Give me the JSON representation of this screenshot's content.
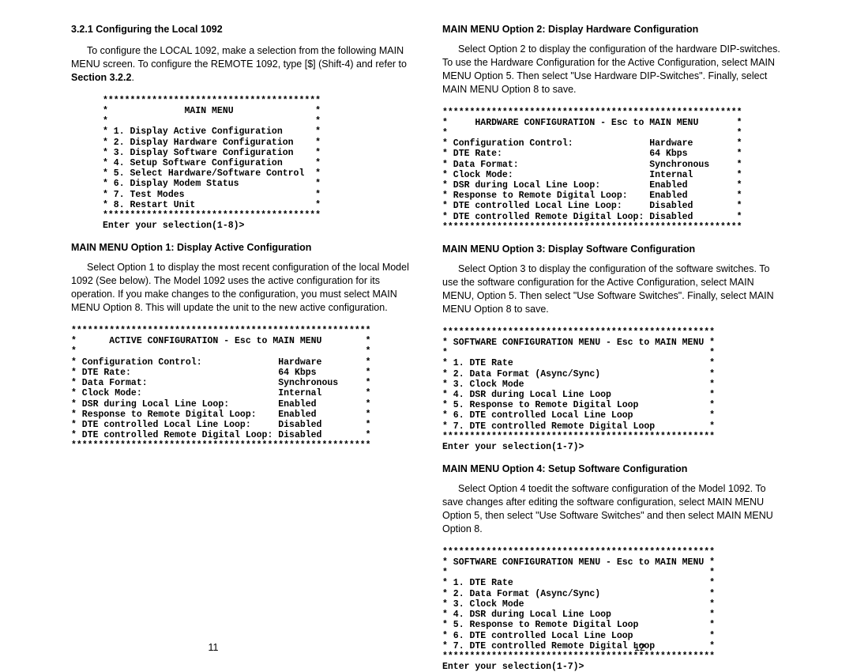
{
  "left": {
    "h1": "3.2.1  Configuring the Local 1092",
    "p1a": "To configure the LOCAL 1092, make a selection from the following MAIN MENU screen.  To configure the REMOTE 1092, type [$] (Shift-4) and refer to ",
    "p1ref": "Section 3.2.2",
    "p1b": ".",
    "main_menu": "****************************************\n*              MAIN MENU               *\n*                                      *\n* 1. Display Active Configuration      *\n* 2. Display Hardware Configuration    *\n* 3. Display Software Configuration    *\n* 4. Setup Software Configuration      *\n* 5. Select Hardware/Software Control  *\n* 6. Display Modem Status              *\n* 7. Test Modes                        *\n* 8. Restart Unit                      *\n****************************************\nEnter your selection(1-8)>",
    "h2": "MAIN MENU Option 1:  Display Active Configuration",
    "p2": "Select Option 1 to display the most recent configuration of the local Model 1092 (See below).  The Model 1092 uses the active configuration for its operation.  If you make changes to the configuration, you must select MAIN MENU Option 8.  This will update the unit to the new active configuration.",
    "active_cfg": "*******************************************************\n*      ACTIVE CONFIGURATION - Esc to MAIN MENU        *\n*                                                     *\n* Configuration Control:              Hardware        *\n* DTE Rate:                           64 Kbps         *\n* Data Format:                        Synchronous     *\n* Clock Mode:                         Internal        *\n* DSR during Local Line Loop:         Enabled         *\n* Response to Remote Digital Loop:    Enabled         *\n* DTE controlled Local Line Loop:     Disabled        *\n* DTE controlled Remote Digital Loop: Disabled        *\n*******************************************************",
    "pagenum": "11"
  },
  "right": {
    "h1": "MAIN MENU Option 2:  Display Hardware Configuration",
    "p1": "Select Option 2 to display the configuration of the hardware DIP-switches.  To use the Hardware Configuration for the Active Configuration, select MAIN MENU Option 5.  Then select \"Use Hardware DIP-Switches\".  Finally, select MAIN MENU Option 8 to save.",
    "hw_cfg": "*******************************************************\n*     HARDWARE CONFIGURATION - Esc to MAIN MENU       *\n*                                                     *\n* Configuration Control:              Hardware        *\n* DTE Rate:                           64 Kbps         *\n* Data Format:                        Synchronous     *\n* Clock Mode:                         Internal        *\n* DSR during Local Line Loop:         Enabled         *\n* Response to Remote Digital Loop:    Enabled         *\n* DTE controlled Local Line Loop:     Disabled        *\n* DTE controlled Remote Digital Loop: Disabled        *\n*******************************************************",
    "h2": "MAIN MENU Option 3:  Display Software Configuration",
    "p2": "Select Option 3 to display the configuration of the software switches.  To use the software configuration for the Active Configuration, select MAIN MENU, Option 5.  Then select \"Use Software Switches\".  Finally, select MAIN MENU Option 8 to save.",
    "sw_menu": "**************************************************\n* SOFTWARE CONFIGURATION MENU - Esc to MAIN MENU *\n*                                                *\n* 1. DTE Rate                                    *\n* 2. Data Format (Async/Sync)                    *\n* 3. Clock Mode                                  *\n* 4. DSR during Local Line Loop                  *\n* 5. Response to Remote Digital Loop             *\n* 6. DTE controlled Local Line Loop              *\n* 7. DTE controlled Remote Digital Loop          *\n**************************************************\nEnter your selection(1-7)>",
    "h3": "MAIN MENU Option 4:  Setup Software Configuration",
    "p3": "Select Option 4 toedit the software configuration of the Model 1092.  To save changes after editing the software configuration, select MAIN MENU Option 5, then select \"Use Software Switches\" and then select MAIN MENU Option 8.",
    "sw_menu2": "**************************************************\n* SOFTWARE CONFIGURATION MENU - Esc to MAIN MENU *\n*                                                *\n* 1. DTE Rate                                    *\n* 2. Data Format (Async/Sync)                    *\n* 3. Clock Mode                                  *\n* 4. DSR during Local Line Loop                  *\n* 5. Response to Remote Digital Loop             *\n* 6. DTE controlled Local Line Loop              *\n* 7. DTE controlled Remote Digital Loop          *\n**************************************************\nEnter your selection(1-7)>",
    "pagenum": "12"
  }
}
